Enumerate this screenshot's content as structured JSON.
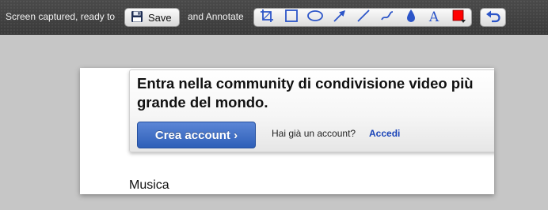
{
  "toolbar": {
    "status_text": "Screen captured, ready to",
    "save_label": "Save",
    "annotate_text": "and Annotate",
    "tools": [
      {
        "name": "crop",
        "icon": "crop-icon"
      },
      {
        "name": "rectangle",
        "icon": "rectangle-icon"
      },
      {
        "name": "ellipse",
        "icon": "ellipse-icon"
      },
      {
        "name": "arrow",
        "icon": "arrow-icon"
      },
      {
        "name": "line",
        "icon": "line-icon"
      },
      {
        "name": "freehand",
        "icon": "freehand-icon"
      },
      {
        "name": "blur",
        "icon": "drop-icon"
      },
      {
        "name": "text",
        "icon": "text-icon",
        "glyph": "A"
      },
      {
        "name": "color",
        "icon": "color-picker-icon",
        "value": "#ff0000"
      }
    ],
    "undo": {
      "icon": "undo-icon"
    }
  },
  "colors": {
    "tool_blue": "#2c55c8",
    "selected_color": "#ff0000",
    "button_blue": "#2e5fb8",
    "link_blue": "#1a44b8"
  },
  "page": {
    "promo": {
      "title": "Entra nella community di condivisione video più grande del mondo.",
      "create_button": "Crea account ›",
      "login_question": "Hai già un account?",
      "login_link": "Accedi"
    },
    "section_title": "Musica"
  }
}
